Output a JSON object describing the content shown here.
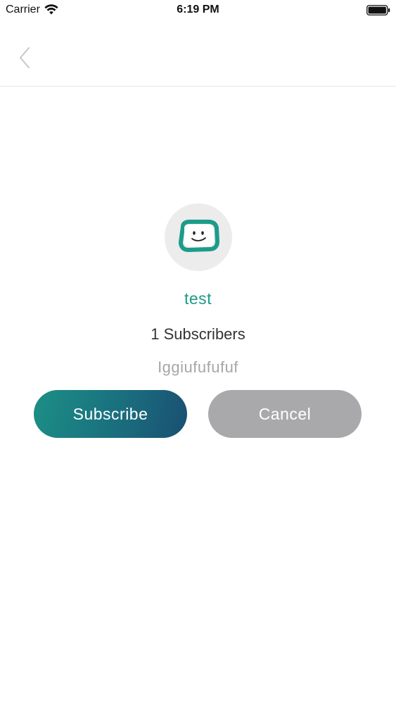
{
  "status_bar": {
    "carrier": "Carrier",
    "time": "6:19 PM"
  },
  "nav": {
    "back_icon": "chevron-left-icon"
  },
  "channel": {
    "avatar_icon": "smiley-tv-icon",
    "name": "test",
    "subscribers": "1 Subscribers",
    "description": "Iggiufufufuf"
  },
  "actions": {
    "subscribe_label": "Subscribe",
    "cancel_label": "Cancel"
  },
  "colors": {
    "accent": "#1f9a86",
    "subscribe_gradient_start": "#1c8f86",
    "subscribe_gradient_end": "#1a4f72",
    "cancel": "#a9a9ab",
    "description": "#a6a6a6"
  }
}
